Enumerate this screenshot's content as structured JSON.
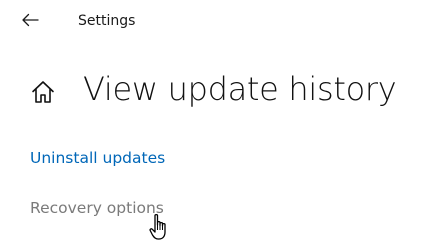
{
  "header": {
    "back_icon": "back-arrow-icon",
    "app_title": "Settings"
  },
  "main": {
    "home_icon": "home-icon",
    "page_title": "View update history",
    "links": [
      {
        "label": "Uninstall updates",
        "color": "#0067b8"
      },
      {
        "label": "Recovery options",
        "color": "#7a7a7a"
      }
    ]
  },
  "pointer": {
    "icon": "hand-pointer-cursor-icon"
  }
}
